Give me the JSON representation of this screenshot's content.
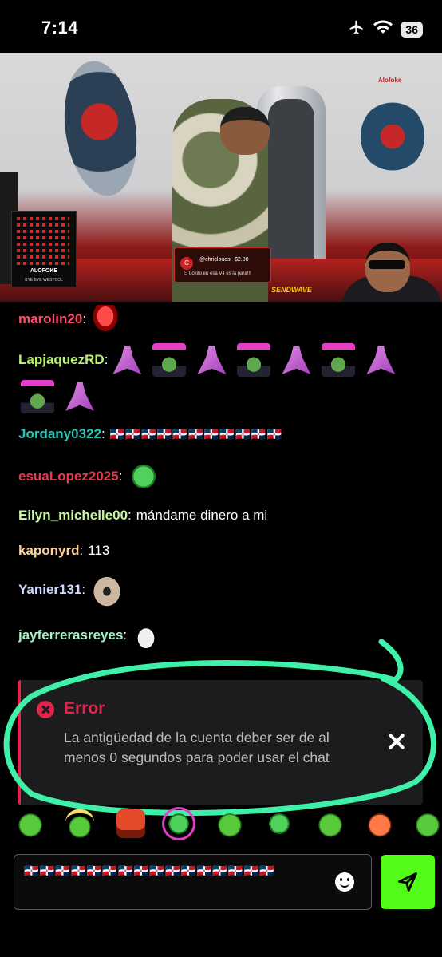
{
  "status_bar": {
    "time": "7:14",
    "battery": "36"
  },
  "video": {
    "qr_caption": "ALOFOKE",
    "qr_subcaption": "BYE BYE WESTCOL",
    "tip": {
      "user": "@chriclouds",
      "amount": "$2.00",
      "message": "El Lokito en esa V4 es la para!!!"
    },
    "sponsor": "SENDWAVE",
    "brand": "Alofoke"
  },
  "chat": {
    "messages": [
      {
        "user": "marolin20",
        "color": "#ff4d6d",
        "text": ""
      },
      {
        "user": "LapjaquezRD",
        "color": "#b5f56b",
        "text": ""
      },
      {
        "user": "Jordany0322",
        "color": "#2ec4b6",
        "text": "🇩🇴🇩🇴🇩🇴🇩🇴🇩🇴🇩🇴🇩🇴🇩🇴🇩🇴🇩🇴🇩🇴"
      },
      {
        "user": "esuaLopez2025",
        "color": "#e8394d",
        "text": ""
      },
      {
        "user": "Eilyn_michelle00",
        "color": "#c8f7a0",
        "text": "mándame dinero a mi"
      },
      {
        "user": "kaponyrd",
        "color": "#ffd29a",
        "text": "113"
      },
      {
        "user": "Yanier131",
        "color": "#c9d9ff",
        "text": ""
      },
      {
        "user": "jayferrerasreyes",
        "color": "#a6f0c6",
        "text": ""
      }
    ]
  },
  "error_toast": {
    "title": "Error",
    "message": "La antigüedad de la cuenta deber ser de al menos 0 segundos para poder usar el chat"
  },
  "input": {
    "value": "🇩🇴🇩🇴🇩🇴🇩🇴🇩🇴🇩🇴🇩🇴🇩🇴🇩🇴🇩🇴🇩🇴🇩🇴🇩🇴🇩🇴🇩🇴🇩🇴"
  },
  "colors": {
    "accent": "#53fc18",
    "error": "#e0254b",
    "highlight": "#3ef0a8"
  },
  "icons": [
    "airplane-icon",
    "wifi-icon",
    "error-icon",
    "close-icon",
    "emoji-icon",
    "send-icon"
  ]
}
